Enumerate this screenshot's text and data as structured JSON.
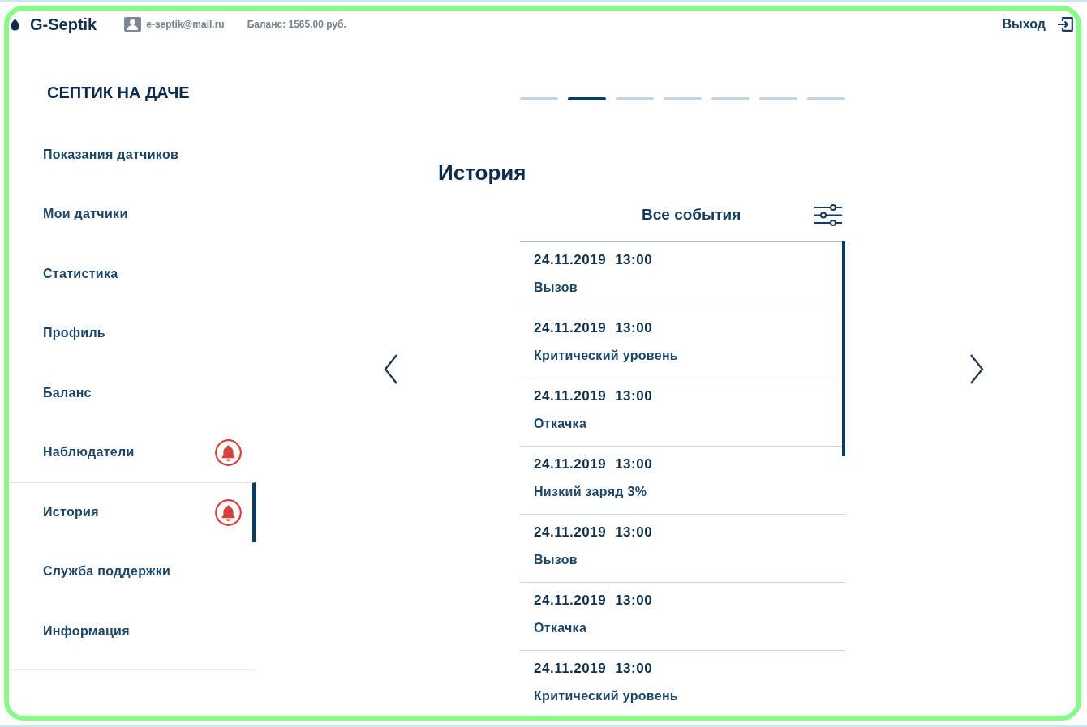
{
  "header": {
    "logo": "G-Septik",
    "email": "e-septik@mail.ru",
    "balance": "Баланс: 1565.00 руб.",
    "logout": "Выход"
  },
  "sidebar": {
    "title": "СЕПТИК НА ДАЧЕ",
    "items": [
      {
        "label": "Показания датчиков",
        "selected": false,
        "alert": false
      },
      {
        "label": "Мои датчики",
        "selected": false,
        "alert": false
      },
      {
        "label": "Статистика",
        "selected": false,
        "alert": false
      },
      {
        "label": "Профиль",
        "selected": false,
        "alert": false
      },
      {
        "label": "Баланс",
        "selected": false,
        "alert": false
      },
      {
        "label": "Наблюдатели",
        "selected": false,
        "alert": true
      },
      {
        "label": "История",
        "selected": true,
        "alert": true
      },
      {
        "label": "Служба поддержки",
        "selected": false,
        "alert": false
      },
      {
        "label": "Информация",
        "selected": false,
        "alert": false
      }
    ]
  },
  "pager": {
    "pages": [
      {
        "selected": false
      },
      {
        "selected": true
      },
      {
        "selected": false
      },
      {
        "selected": false
      },
      {
        "selected": false
      },
      {
        "selected": false
      },
      {
        "selected": false
      }
    ]
  },
  "history": {
    "title": "История",
    "filter": "Все события",
    "events": [
      {
        "date": "24.11.2019",
        "time": "13:00",
        "text": "Вызов"
      },
      {
        "date": "24.11.2019",
        "time": "13:00",
        "text": "Критический уровень"
      },
      {
        "date": "24.11.2019",
        "time": "13:00",
        "text": "Откачка"
      },
      {
        "date": "24.11.2019",
        "time": "13:00",
        "text": "Низкий заряд 3%"
      },
      {
        "date": "24.11.2019",
        "time": "13:00",
        "text": "Вызов"
      },
      {
        "date": "24.11.2019",
        "time": "13:00",
        "text": "Откачка"
      },
      {
        "date": "24.11.2019",
        "time": "13:00",
        "text": "Критический уровень"
      }
    ]
  }
}
